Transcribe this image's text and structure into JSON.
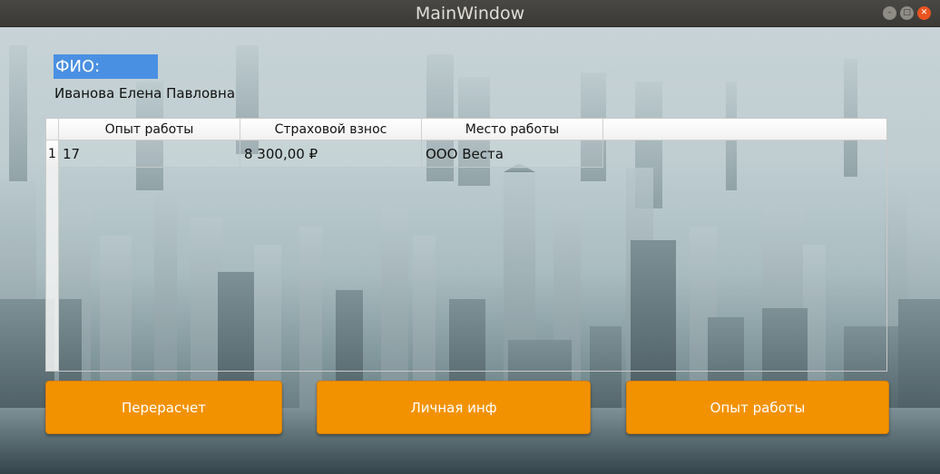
{
  "window": {
    "title": "MainWindow"
  },
  "form": {
    "fio_label": "ФИО:",
    "fio_value": "Иванова Елена Павловна"
  },
  "table": {
    "headers": [
      "Опыт работы",
      "Страховой взнос",
      "Место работы"
    ],
    "rows": [
      {
        "num": "1",
        "cells": [
          "17",
          "8 300,00 ₽",
          "ООО Веста"
        ]
      }
    ]
  },
  "buttons": {
    "recalc": "Перерасчет",
    "personal": "Личная инф",
    "experience": "Опыт работы"
  },
  "colors": {
    "accent_button": "#f39200",
    "label_highlight": "#4a90e2",
    "titlebar": "#3b3935",
    "close_button": "#e95420"
  }
}
